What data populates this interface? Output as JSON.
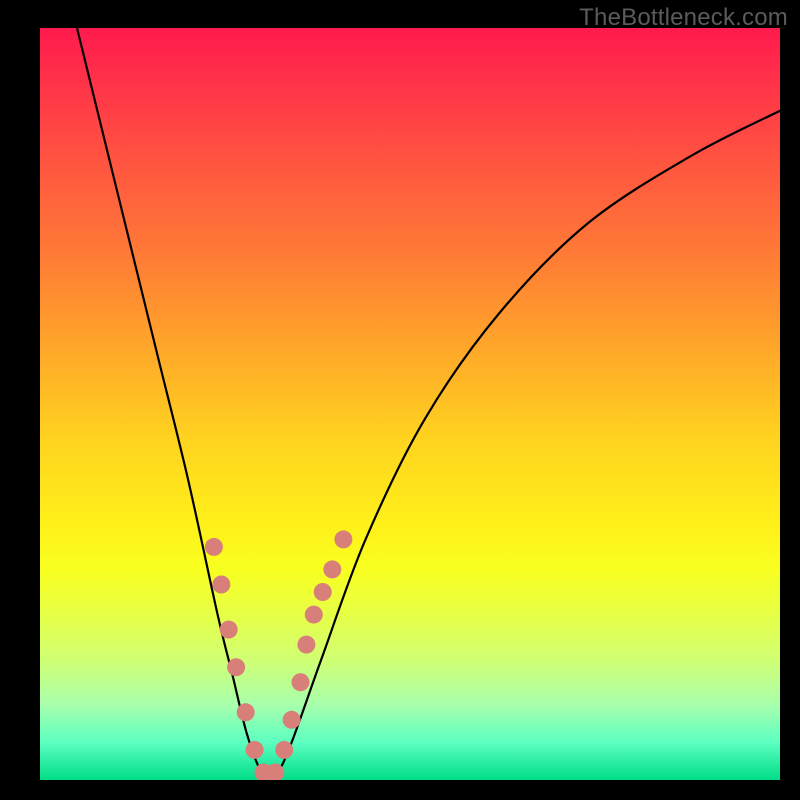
{
  "watermark": "TheBottleneck.com",
  "colors": {
    "curve": "#000000",
    "dots": "#d87f7a",
    "background_frame": "#000000"
  },
  "chart_data": {
    "type": "line",
    "title": "",
    "xlabel": "",
    "ylabel": "",
    "xlim": [
      0,
      100
    ],
    "ylim": [
      0,
      100
    ],
    "grid": false,
    "legend": false,
    "series": [
      {
        "name": "bottleneck-curve",
        "x": [
          5,
          8,
          12,
          16,
          20,
          24,
          26,
          28,
          30,
          32,
          34,
          38,
          44,
          52,
          62,
          74,
          88,
          100
        ],
        "y": [
          100,
          88,
          72,
          56,
          40,
          22,
          14,
          6,
          1,
          1,
          5,
          16,
          32,
          48,
          62,
          74,
          83,
          89
        ]
      }
    ],
    "highlight_points": {
      "name": "pink-dots",
      "x_pct": [
        23.5,
        24.5,
        25.5,
        26.5,
        27.8,
        29.0,
        30.2,
        31.8,
        33.0,
        34.0,
        35.2,
        36.0,
        37.0,
        38.2,
        39.5,
        41.0
      ],
      "y_pct": [
        31,
        26,
        20,
        15,
        9,
        4,
        1,
        1,
        4,
        8,
        13,
        18,
        22,
        25,
        28,
        32
      ]
    }
  }
}
